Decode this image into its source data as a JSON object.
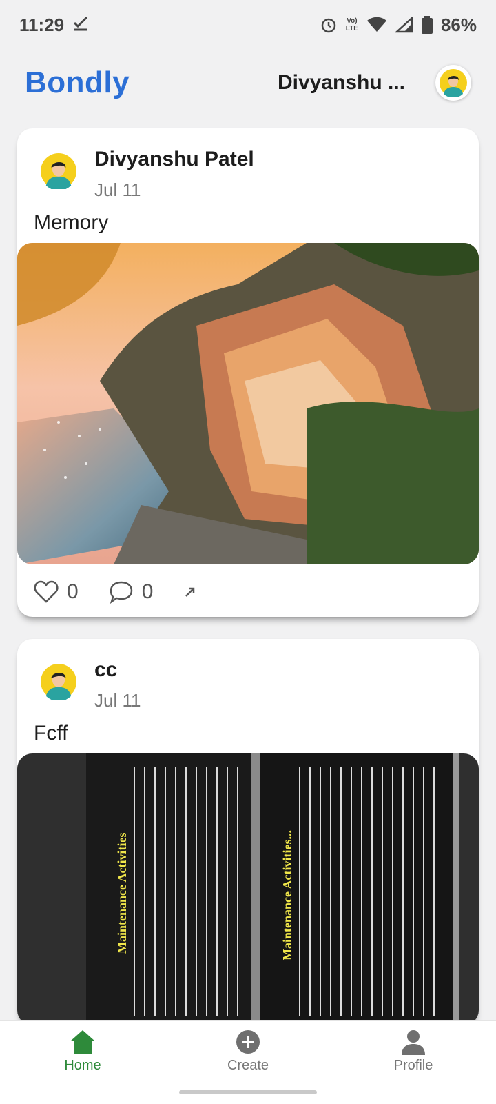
{
  "status_bar": {
    "time": "11:29",
    "lte_label": "LTE",
    "volte_label": "Vo)",
    "battery": "86%"
  },
  "header": {
    "brand": "Bondly",
    "user_name": "Divyanshu ..."
  },
  "posts": [
    {
      "author": "Divyanshu Patel",
      "date": "Jul 11",
      "text": "Memory",
      "likes": "0",
      "comments": "0",
      "image": "coastal-village-photo"
    },
    {
      "author": "cc",
      "date": "Jul 11",
      "text": "Fcff",
      "image": "textbook-page-photo",
      "image_text": {
        "left_heading": "Maintenance Activities",
        "right_heading": "Maintenance Activities..."
      }
    }
  ],
  "nav": {
    "home": "Home",
    "create": "Create",
    "profile": "Profile"
  },
  "colors": {
    "brand": "#2c6fd6",
    "active_nav": "#2e8a3a"
  }
}
